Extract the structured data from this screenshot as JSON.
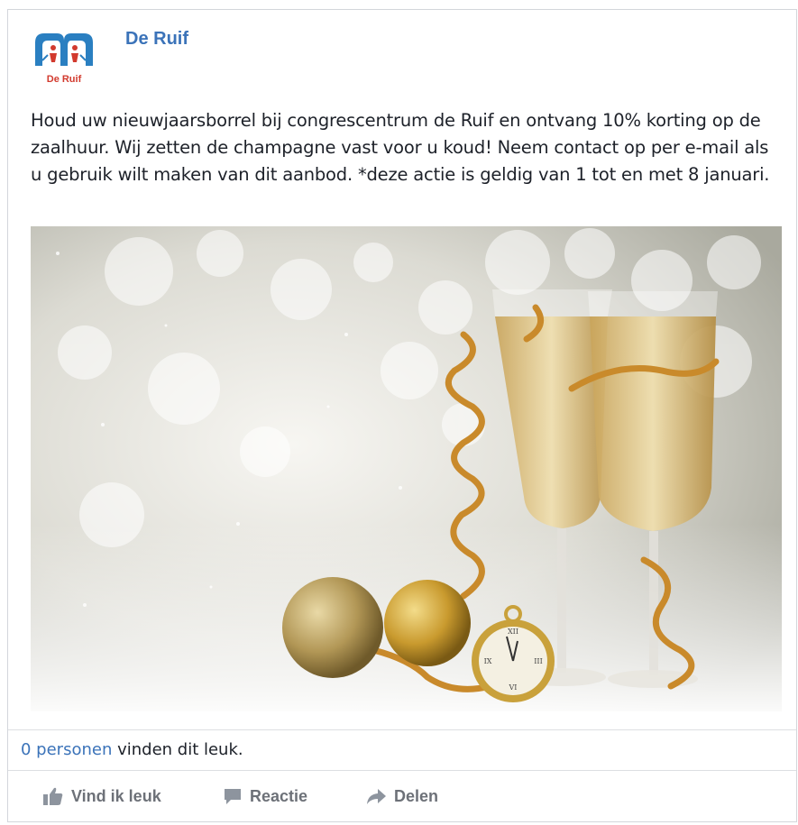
{
  "post": {
    "page_name": "De Ruif",
    "logo_text": "De Ruif",
    "text": "Houd uw nieuwjaarsborrel bij congrescentrum de Ruif en ontvang 10% korting op de zaalhuur. Wij zetten de champagne vast voor u koud! Neem contact op per e-mail als u gebruik wilt maken van dit aanbod. *deze actie is geldig van 1 tot en met 8 januari.",
    "likes_link": "0 personen",
    "likes_suffix": " vinden dit leuk."
  },
  "actions": {
    "like": {
      "label": "Vind ik leuk",
      "icon": "thumbs-up-icon"
    },
    "comment": {
      "label": "Reactie",
      "icon": "comment-icon"
    },
    "share": {
      "label": "Delen",
      "icon": "share-arrow-icon"
    }
  },
  "colors": {
    "link": "#3b73b9",
    "action_gray": "#6d7178",
    "logo_blue": "#2a7fc1",
    "logo_red": "#d23a2e"
  }
}
